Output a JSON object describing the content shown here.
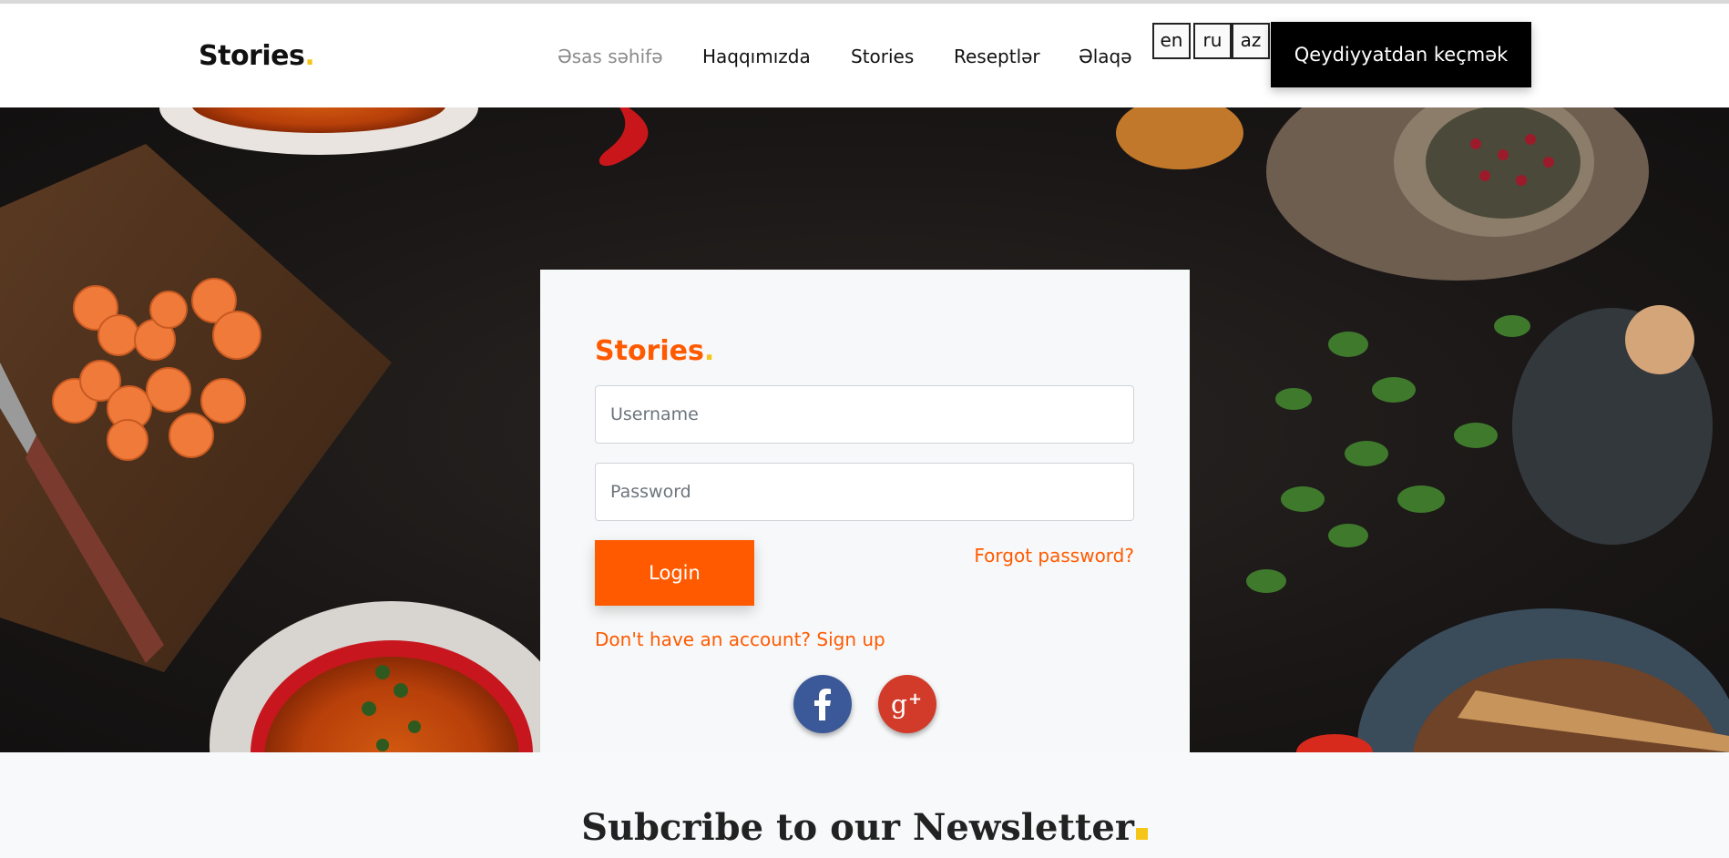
{
  "header": {
    "logo": "Stories",
    "logo_dot": ".",
    "nav": [
      {
        "label": "Əsas səhifə",
        "active": true
      },
      {
        "label": "Haqqımızda",
        "active": false
      },
      {
        "label": "Stories",
        "active": false
      },
      {
        "label": "Reseptlər",
        "active": false
      },
      {
        "label": "Əlaqə",
        "active": false
      }
    ],
    "languages": [
      "en",
      "ru",
      "az"
    ],
    "register_label": "Qeydiyyatdan keçmək"
  },
  "login": {
    "logo": "Stories",
    "logo_dot": ".",
    "username_placeholder": "Username",
    "password_placeholder": "Password",
    "login_label": "Login",
    "forgot_label": "Forgot password?",
    "signup_label": "Don't have an account? Sign up",
    "social": [
      {
        "name": "facebook",
        "icon": "facebook-icon",
        "color": "#3b5998"
      },
      {
        "name": "google-plus",
        "icon": "google-plus-icon",
        "color": "#d23a2a"
      }
    ]
  },
  "newsletter": {
    "title": "Subcribe to our Newsletter"
  },
  "colors": {
    "accent": "#ff5a00",
    "dot": "#f5c518",
    "dark": "#000000"
  }
}
